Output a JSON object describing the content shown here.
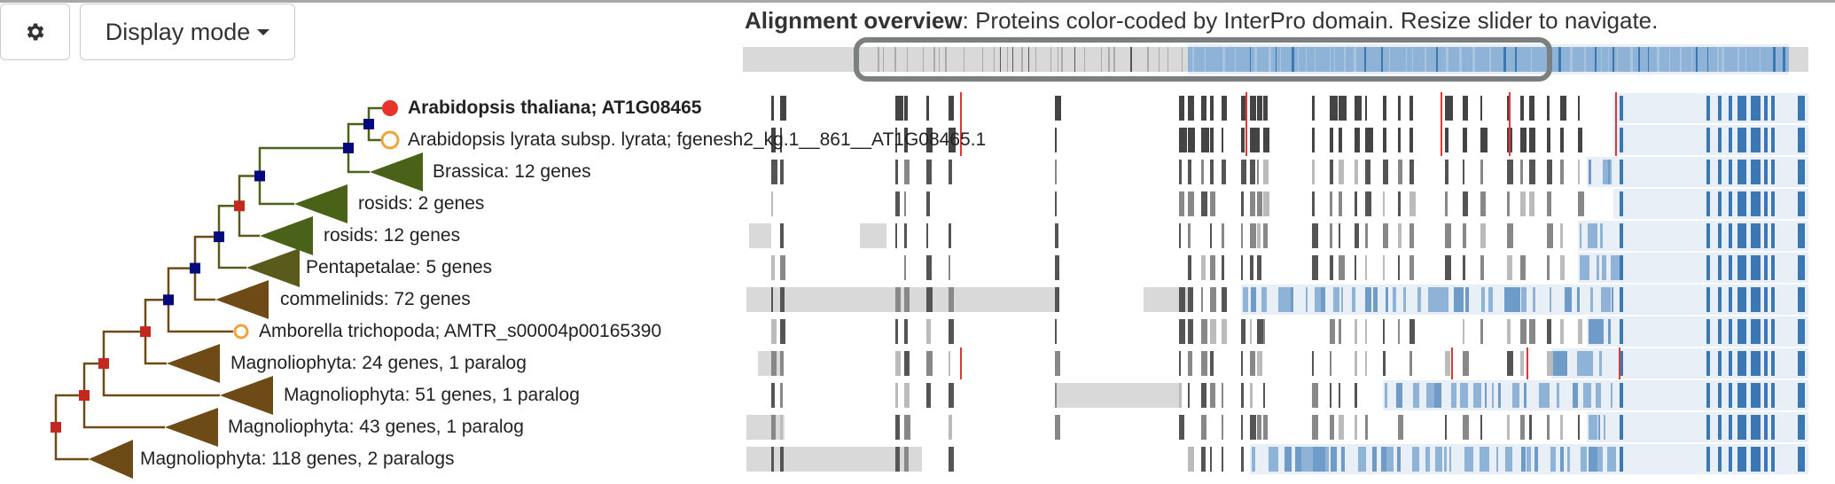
{
  "toolbar": {
    "settings_icon": "gear-icon",
    "display_mode_label": "Display mode",
    "display_mode_icon": "caret-down-icon"
  },
  "overview": {
    "title_bold": "Alignment overview",
    "title_rest": ": Proteins color-coded by InterPro domain. Resize slider to navigate."
  },
  "colors": {
    "domain_blue": "#3b78b3",
    "domain_light_blue": "#8fb3d6",
    "domain_bg": "#e9eff7",
    "gap_gray": "#444444",
    "light_gray": "#d9d9d9",
    "mismatch_red": "#e0383a",
    "node_duplication": "#c4271f",
    "node_speciation": "#05097e",
    "clade_green": "#4a6218",
    "clade_olive": "#5a5a1c",
    "clade_brown": "#6e4a17",
    "query_leaf": "#e7332a",
    "other_leaf": "#f0a33a"
  },
  "tree": {
    "rows": [
      {
        "label": "Arabidopsis thaliana; AT1G08465",
        "type": "leaf-query",
        "bold": true
      },
      {
        "label": "Arabidopsis lyrata subsp. lyrata; fgenesh2_kg.1__861__AT1G08465.1",
        "type": "leaf"
      },
      {
        "label": "Brassica: 12 genes",
        "type": "clade"
      },
      {
        "label": "rosids: 2 genes",
        "type": "clade"
      },
      {
        "label": "rosids: 12 genes",
        "type": "clade"
      },
      {
        "label": "Pentapetalae: 5 genes",
        "type": "clade"
      },
      {
        "label": "commelinids: 72 genes",
        "type": "clade"
      },
      {
        "label": "Amborella trichopoda; AMTR_s00004p00165390",
        "type": "leaf"
      },
      {
        "label": "Magnoliophyta: 24 genes, 1 paralog",
        "type": "clade"
      },
      {
        "label": "Magnoliophyta: 51 genes, 1 paralog",
        "type": "clade"
      },
      {
        "label": "Magnoliophyta: 43 genes, 1 paralog",
        "type": "clade"
      },
      {
        "label": "Magnoliophyta: 118 genes, 2 paralogs",
        "type": "clade"
      }
    ],
    "nodes": [
      {
        "kind": "speciation"
      },
      {
        "kind": "speciation"
      },
      {
        "kind": "speciation"
      },
      {
        "kind": "duplication"
      },
      {
        "kind": "speciation"
      },
      {
        "kind": "speciation"
      },
      {
        "kind": "speciation"
      },
      {
        "kind": "duplication"
      },
      {
        "kind": "duplication"
      },
      {
        "kind": "duplication"
      },
      {
        "kind": "duplication"
      }
    ]
  }
}
